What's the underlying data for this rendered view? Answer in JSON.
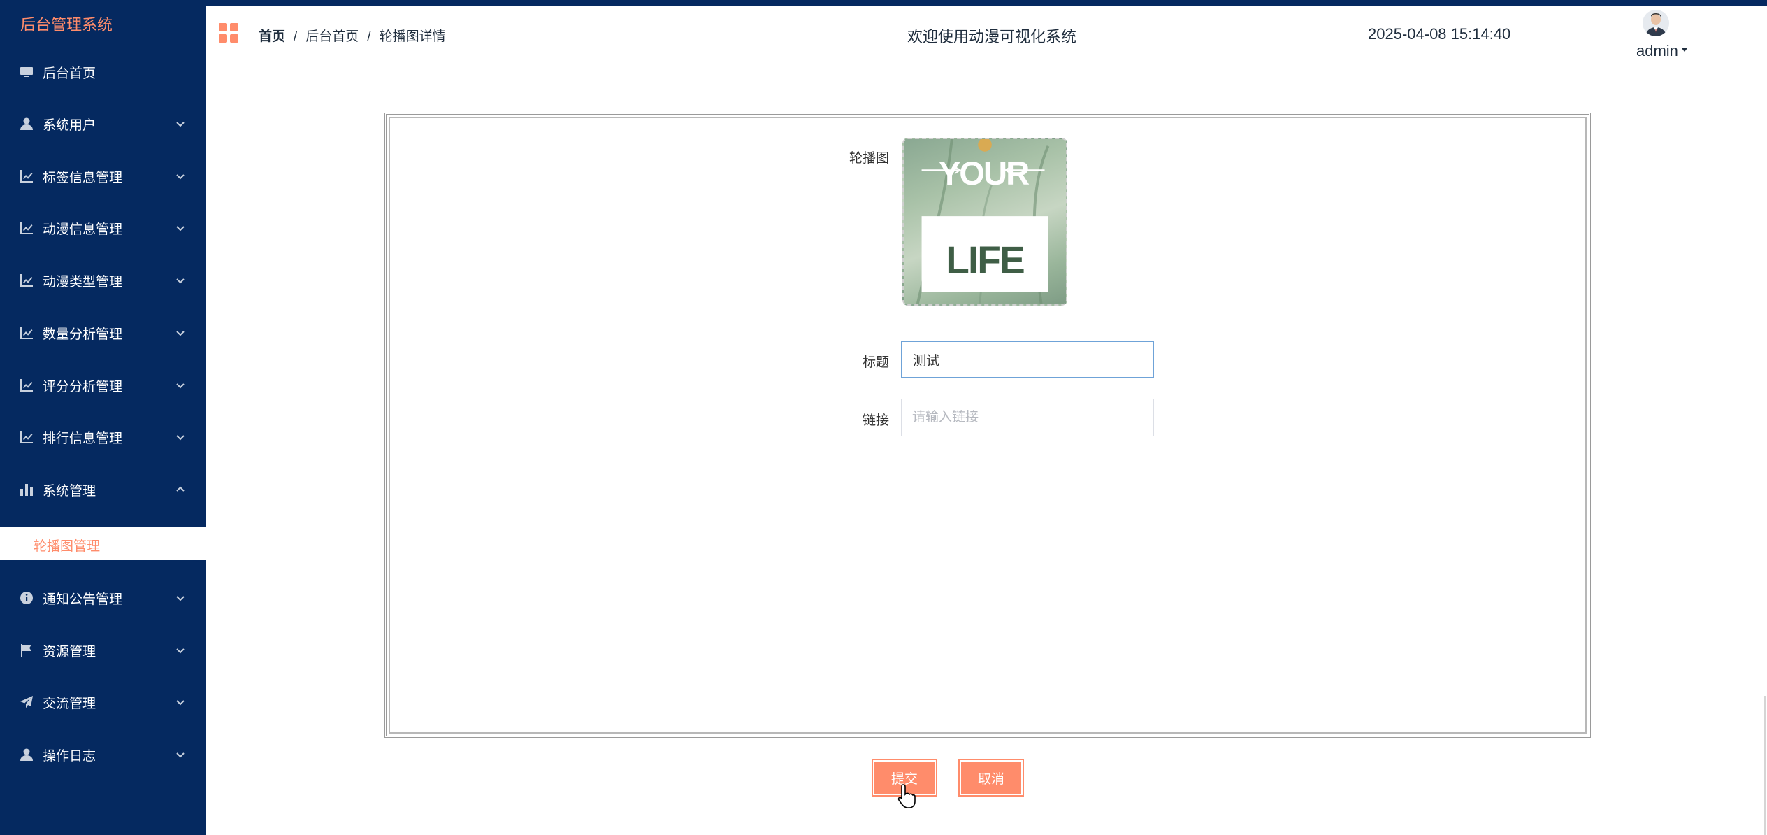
{
  "sidebar": {
    "title": "后台管理系统",
    "items": [
      {
        "label": "后台首页",
        "icon": "monitor-icon"
      },
      {
        "label": "系统用户",
        "icon": "user-icon"
      },
      {
        "label": "标签信息管理",
        "icon": "line-chart-icon"
      },
      {
        "label": "动漫信息管理",
        "icon": "line-chart-icon"
      },
      {
        "label": "动漫类型管理",
        "icon": "line-chart-icon"
      },
      {
        "label": "数量分析管理",
        "icon": "line-chart-icon"
      },
      {
        "label": "评分分析管理",
        "icon": "line-chart-icon"
      },
      {
        "label": "排行信息管理",
        "icon": "line-chart-icon"
      },
      {
        "label": "系统管理",
        "icon": "bar-chart-icon",
        "expanded": true
      },
      {
        "label": "通知公告管理",
        "icon": "info-icon"
      },
      {
        "label": "资源管理",
        "icon": "flag-icon"
      },
      {
        "label": "交流管理",
        "icon": "paper-plane-icon"
      },
      {
        "label": "操作日志",
        "icon": "user-icon"
      }
    ],
    "active_subitem": "轮播图管理"
  },
  "header": {
    "breadcrumb": [
      "首页",
      "后台首页",
      "轮播图详情"
    ],
    "welcome": "欢迎使用动漫可视化系统",
    "datetime": "2025-04-08 15:14:40",
    "username": "admin"
  },
  "form": {
    "image_label": "轮播图",
    "image_text_top": "YOUR",
    "image_text_bottom": "LIFE",
    "title_label": "标题",
    "title_value": "测试",
    "link_label": "链接",
    "link_placeholder": "请输入链接"
  },
  "buttons": {
    "submit": "提交",
    "cancel": "取消"
  },
  "colors": {
    "sidebar_bg": "#052960",
    "accent": "#ff8c6b",
    "input_focus": "#6fa3d8"
  }
}
